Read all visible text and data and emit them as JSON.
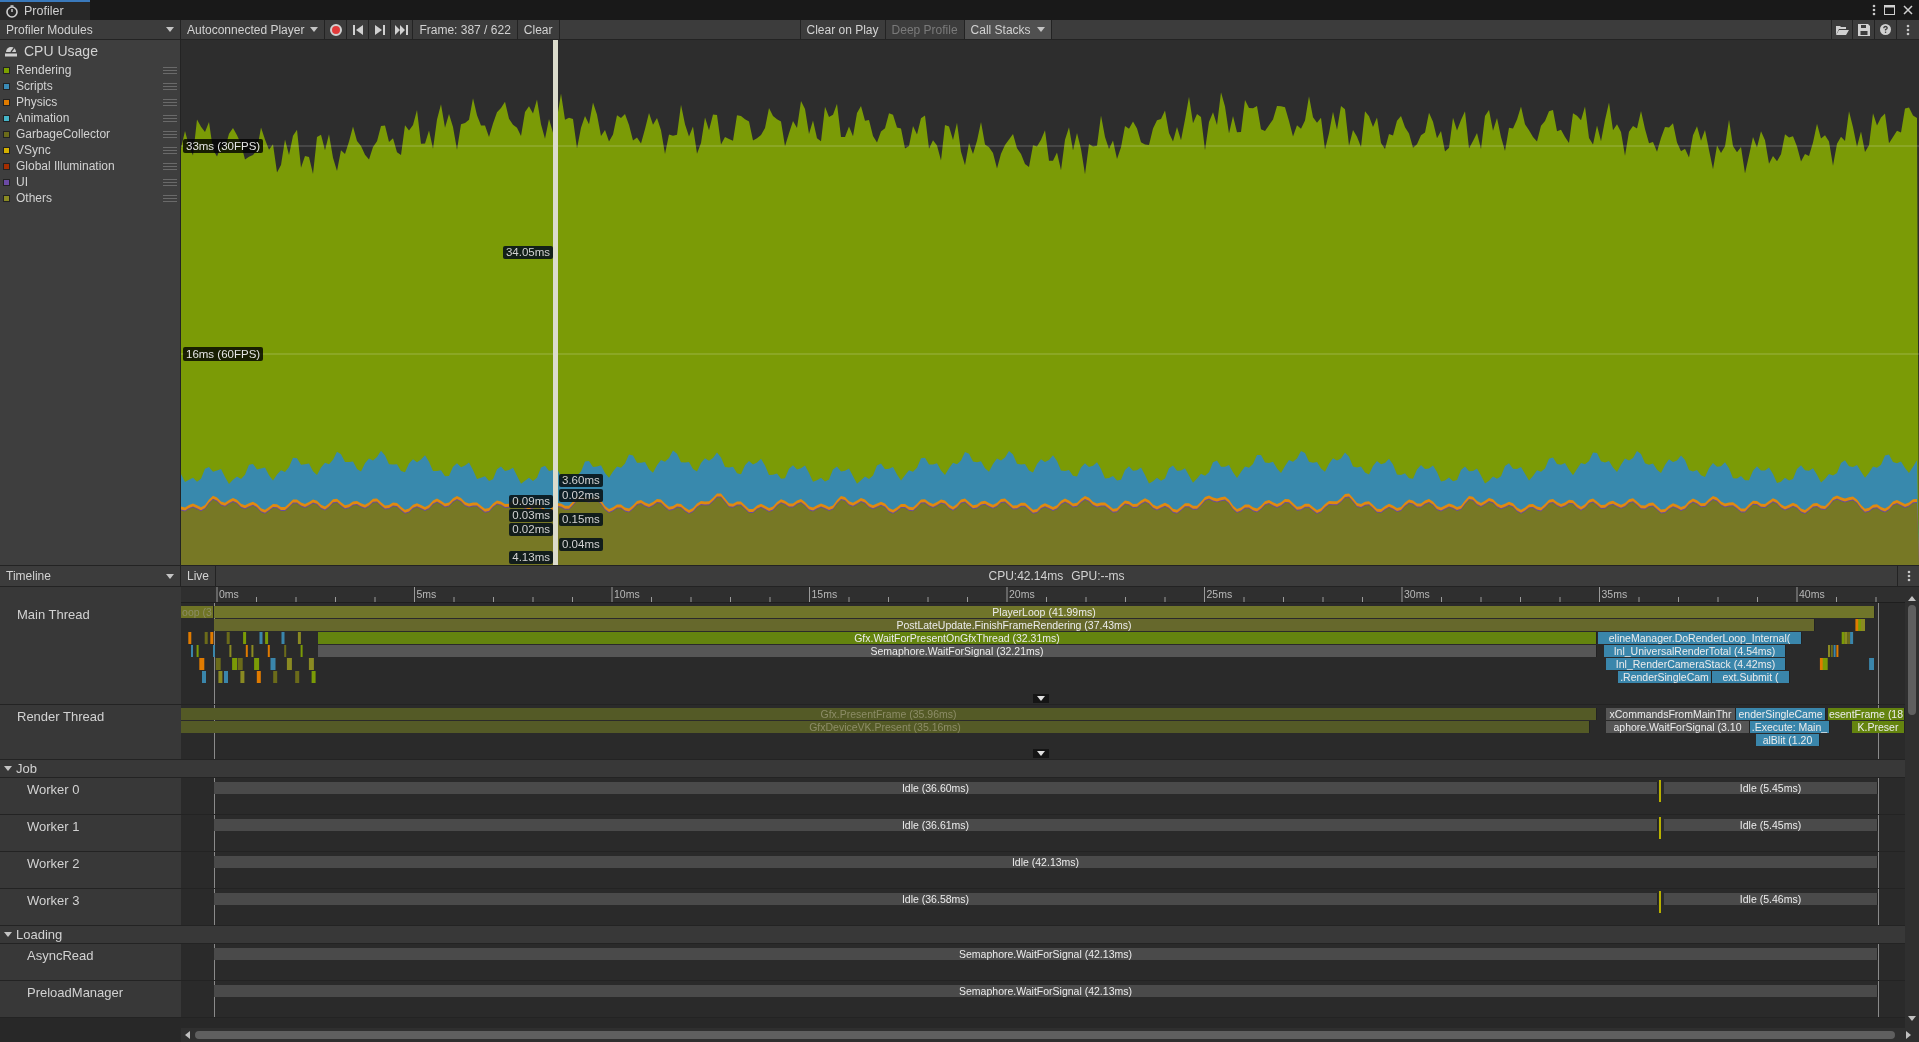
{
  "window": {
    "tab": "Profiler",
    "selected": true
  },
  "toolbar": {
    "modules": "Profiler Modules",
    "target": "Autoconnected Player",
    "record": {
      "on": true
    },
    "frame": "Frame: 387 / 622",
    "clear": "Clear",
    "toggles": [
      {
        "label": "Clear on Play",
        "selected": false,
        "disabled": false,
        "dropdown": false
      },
      {
        "label": "Deep Profile",
        "selected": false,
        "disabled": true,
        "dropdown": false
      },
      {
        "label": "Call Stacks",
        "selected": true,
        "disabled": false,
        "dropdown": true
      }
    ]
  },
  "module": {
    "title": "CPU Usage",
    "legend": [
      {
        "label": "Rendering",
        "color": "#7ba000"
      },
      {
        "label": "Scripts",
        "color": "#3a8ab5"
      },
      {
        "label": "Physics",
        "color": "#e07b00"
      },
      {
        "label": "Animation",
        "color": "#45b5c8"
      },
      {
        "label": "GarbageCollector",
        "color": "#6b6b1a"
      },
      {
        "label": "VSync",
        "color": "#d4b000"
      },
      {
        "label": "Global Illumination",
        "color": "#a62e00"
      },
      {
        "label": "UI",
        "color": "#6b4aa5"
      },
      {
        "label": "Others",
        "color": "#8a8a22"
      }
    ]
  },
  "chart": {
    "reference_lines": [
      "33ms (30FPS)",
      "16ms (60FPS)"
    ],
    "cursor_labels": [
      {
        "text": "34.05ms"
      },
      {
        "text": "3.60ms"
      },
      {
        "text": "0.09ms"
      },
      {
        "text": "0.02ms"
      },
      {
        "text": "0.03ms"
      },
      {
        "text": "0.15ms"
      },
      {
        "text": "0.02ms"
      },
      {
        "text": "0.04ms"
      },
      {
        "text": "4.13ms"
      }
    ]
  },
  "timeline": {
    "view": "Timeline",
    "live": {
      "label": "Live",
      "selected": false
    },
    "cpu": "CPU:42.14ms",
    "gpu": "GPU:--ms",
    "ruler": [
      "0ms",
      "5ms",
      "10ms",
      "15ms",
      "20ms",
      "25ms",
      "30ms",
      "35ms",
      "40ms"
    ],
    "sections": [
      {
        "kind": "thread",
        "name": "Main Thread",
        "more": true,
        "bars": [
          {
            "label": "oop (3",
            "kind": "faded",
            "color": "#6f7425"
          },
          {
            "label": "PlayerLoop (41.99ms)",
            "kind": "current",
            "color": "#70752a",
            "children": [
              {
                "label": "PostLateUpdate.FinishFrameRendering (37.43ms)",
                "kind": "current",
                "color": "#66682c",
                "children": [
                  {
                    "label": "Gfx.WaitForPresentOnGfxThread (32.31ms)",
                    "kind": "current",
                    "color": "#64840f",
                    "children": [
                      {
                        "label": "Semaphore.WaitForSignal (32.21ms)",
                        "kind": "current",
                        "color": "#565656"
                      }
                    ]
                  },
                  {
                    "label": "elineManager.DoRenderLoop_Internal(",
                    "kind": "current",
                    "color": "#3a86ab",
                    "children": [
                      {
                        "label": "Inl_UniversalRenderTotal (4.54ms)",
                        "kind": "current",
                        "color": "#3a86ab",
                        "children": [
                          {
                            "label": "Inl_RenderCameraStack (4.42ms)",
                            "kind": "current",
                            "color": "#3a86ab",
                            "children": [
                              {
                                "label": ".RenderSingleCam",
                                "kind": "current",
                                "color": "#3a86ab"
                              },
                              {
                                "label": "ext.Submit (",
                                "kind": "current",
                                "color": "#3a86ab"
                              }
                            ]
                          }
                        ]
                      }
                    ]
                  }
                ]
              }
            ]
          }
        ]
      },
      {
        "kind": "thread",
        "name": "Render Thread",
        "more": true,
        "bars": [
          {
            "label": "Gfx.PresentFrame (35.96ms)",
            "kind": "faded",
            "color": "#545a26",
            "children": [
              {
                "label": "GfxDeviceVK.Present (35.16ms)",
                "kind": "faded",
                "color": "#545a26"
              }
            ]
          },
          {
            "label": "xCommandsFromMainThr",
            "kind": "current",
            "color": "#565656",
            "children": [
              {
                "label": "aphore.WaitForSignal (3.10",
                "kind": "current",
                "color": "#565656"
              }
            ]
          },
          {
            "label": "enderSingleCame",
            "kind": "current",
            "color": "#3a86ab",
            "children": [
              {
                "label": ".Execute: Main_",
                "kind": "current",
                "color": "#3a86ab",
                "children": [
                  {
                    "label": "alBlit (1.20",
                    "kind": "current",
                    "color": "#3a86ab"
                  }
                ]
              }
            ]
          },
          {
            "label": "esentFrame (18",
            "kind": "current",
            "color": "#64840f",
            "children": [
              {
                "label": "K.Preser",
                "kind": "current",
                "color": "#64840f"
              }
            ]
          }
        ]
      },
      {
        "kind": "group",
        "name": "Job",
        "expanded": true,
        "children": [
          {
            "kind": "thread",
            "name": "Worker 0",
            "more": false,
            "bars": [
              {
                "label": "Idle (36.60ms)",
                "kind": "current",
                "color": "#4a4a4a"
              },
              {
                "label": "Idle (5.45ms)",
                "kind": "current",
                "color": "#4a4a4a"
              }
            ]
          },
          {
            "kind": "thread",
            "name": "Worker 1",
            "more": false,
            "bars": [
              {
                "label": "Idle (36.61ms)",
                "kind": "current",
                "color": "#4a4a4a"
              },
              {
                "label": "Idle (5.45ms)",
                "kind": "current",
                "color": "#4a4a4a"
              }
            ]
          },
          {
            "kind": "thread",
            "name": "Worker 2",
            "more": false,
            "bars": [
              {
                "label": "Idle (42.13ms)",
                "kind": "current",
                "color": "#4a4a4a"
              }
            ]
          },
          {
            "kind": "thread",
            "name": "Worker 3",
            "more": false,
            "bars": [
              {
                "label": "Idle (36.58ms)",
                "kind": "current",
                "color": "#4a4a4a"
              },
              {
                "label": "Idle (5.46ms)",
                "kind": "current",
                "color": "#4a4a4a"
              }
            ]
          }
        ]
      },
      {
        "kind": "group",
        "name": "Loading",
        "expanded": true,
        "children": [
          {
            "kind": "thread",
            "name": "AsyncRead",
            "more": false,
            "bars": [
              {
                "label": "Semaphore.WaitForSignal (42.13ms)",
                "kind": "current",
                "color": "#4a4a4a"
              }
            ]
          },
          {
            "kind": "thread",
            "name": "PreloadManager",
            "more": false,
            "bars": [
              {
                "label": "Semaphore.WaitForSignal (42.13ms)",
                "kind": "current",
                "color": "#4a4a4a"
              }
            ]
          }
        ]
      }
    ]
  }
}
